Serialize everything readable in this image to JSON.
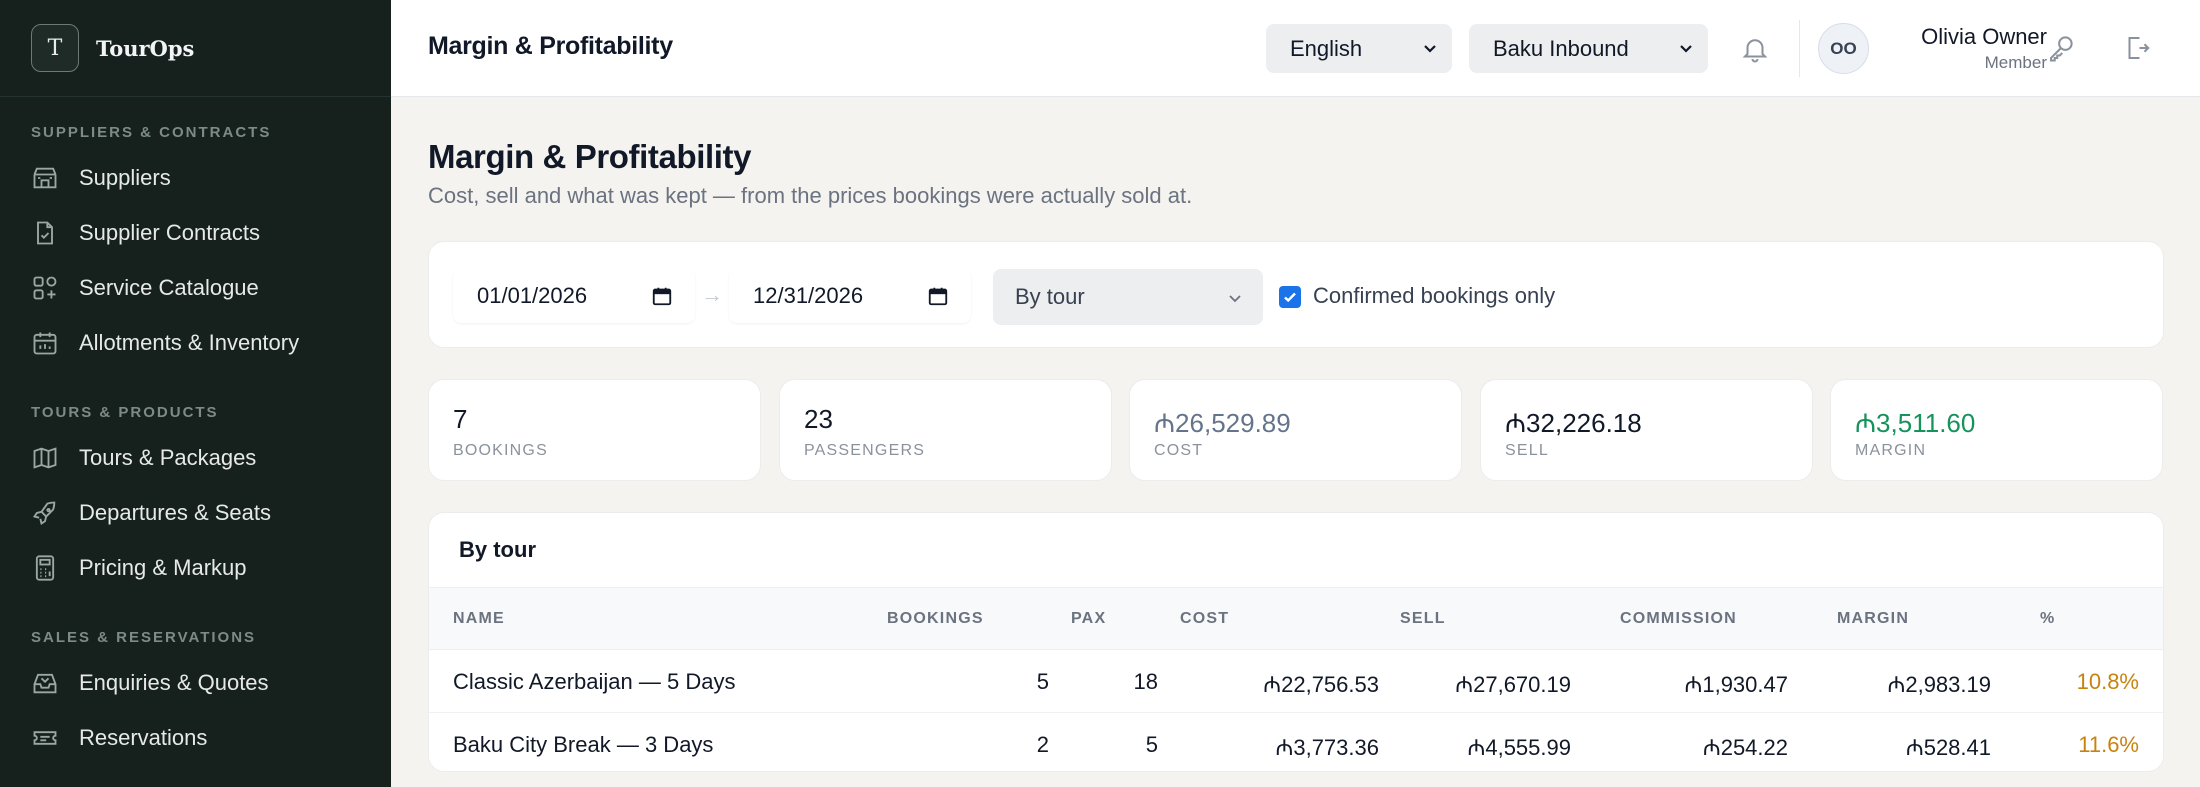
{
  "brand": {
    "logo_letter": "T",
    "name": "TourOps"
  },
  "sidebar": {
    "sections": [
      {
        "title": "Suppliers & Contracts",
        "items": [
          {
            "label": "Suppliers",
            "icon": "store-icon"
          },
          {
            "label": "Supplier Contracts",
            "icon": "file-check-icon"
          },
          {
            "label": "Service Catalogue",
            "icon": "grid-plus-icon"
          },
          {
            "label": "Allotments & Inventory",
            "icon": "calendar-icon"
          }
        ]
      },
      {
        "title": "Tours & Products",
        "items": [
          {
            "label": "Tours & Packages",
            "icon": "map-icon"
          },
          {
            "label": "Departures & Seats",
            "icon": "rocket-icon"
          },
          {
            "label": "Pricing & Markup",
            "icon": "calculator-icon"
          }
        ]
      },
      {
        "title": "Sales & Reservations",
        "items": [
          {
            "label": "Enquiries & Quotes",
            "icon": "inbox-icon"
          },
          {
            "label": "Reservations",
            "icon": "ticket-icon"
          }
        ]
      }
    ]
  },
  "topbar": {
    "title": "Margin & Profitability",
    "language": "English",
    "company": "Baku Inbound",
    "user": {
      "initials": "OO",
      "name": "Olivia Owner",
      "role": "Member"
    }
  },
  "page": {
    "title": "Margin & Profitability",
    "subtitle": "Cost, sell and what was kept — from the prices bookings were actually sold at."
  },
  "filters": {
    "date_from": "01/01/2026",
    "date_to": "12/31/2026",
    "arrow": "→",
    "group_by": "By tour",
    "confirmed_only_label": "Confirmed bookings only",
    "confirmed_only": true
  },
  "stats": [
    {
      "value": "7",
      "label": "Bookings",
      "color": "#111827"
    },
    {
      "value": "23",
      "label": "Passengers",
      "color": "#111827"
    },
    {
      "value": "₼26,529.89",
      "label": "Cost",
      "color": "#64748b"
    },
    {
      "value": "₼32,226.18",
      "label": "Sell",
      "color": "#111827"
    },
    {
      "value": "₼3,511.60",
      "label": "Margin",
      "color": "#15935b"
    }
  ],
  "table": {
    "heading": "By tour",
    "columns": [
      "Name",
      "Bookings",
      "Pax",
      "Cost",
      "Sell",
      "Commission",
      "Margin",
      "%"
    ],
    "rows": [
      {
        "name": "Classic Azerbaijan — 5 Days",
        "bookings": "5",
        "pax": "18",
        "cost": "₼22,756.53",
        "sell": "₼27,670.19",
        "commission": "₼1,930.47",
        "margin": "₼2,983.19",
        "pct": "10.8%"
      },
      {
        "name": "Baku City Break — 3 Days",
        "bookings": "2",
        "pax": "5",
        "cost": "₼3,773.36",
        "sell": "₼4,555.99",
        "commission": "₼254.22",
        "margin": "₼528.41",
        "pct": "11.6%"
      }
    ]
  }
}
